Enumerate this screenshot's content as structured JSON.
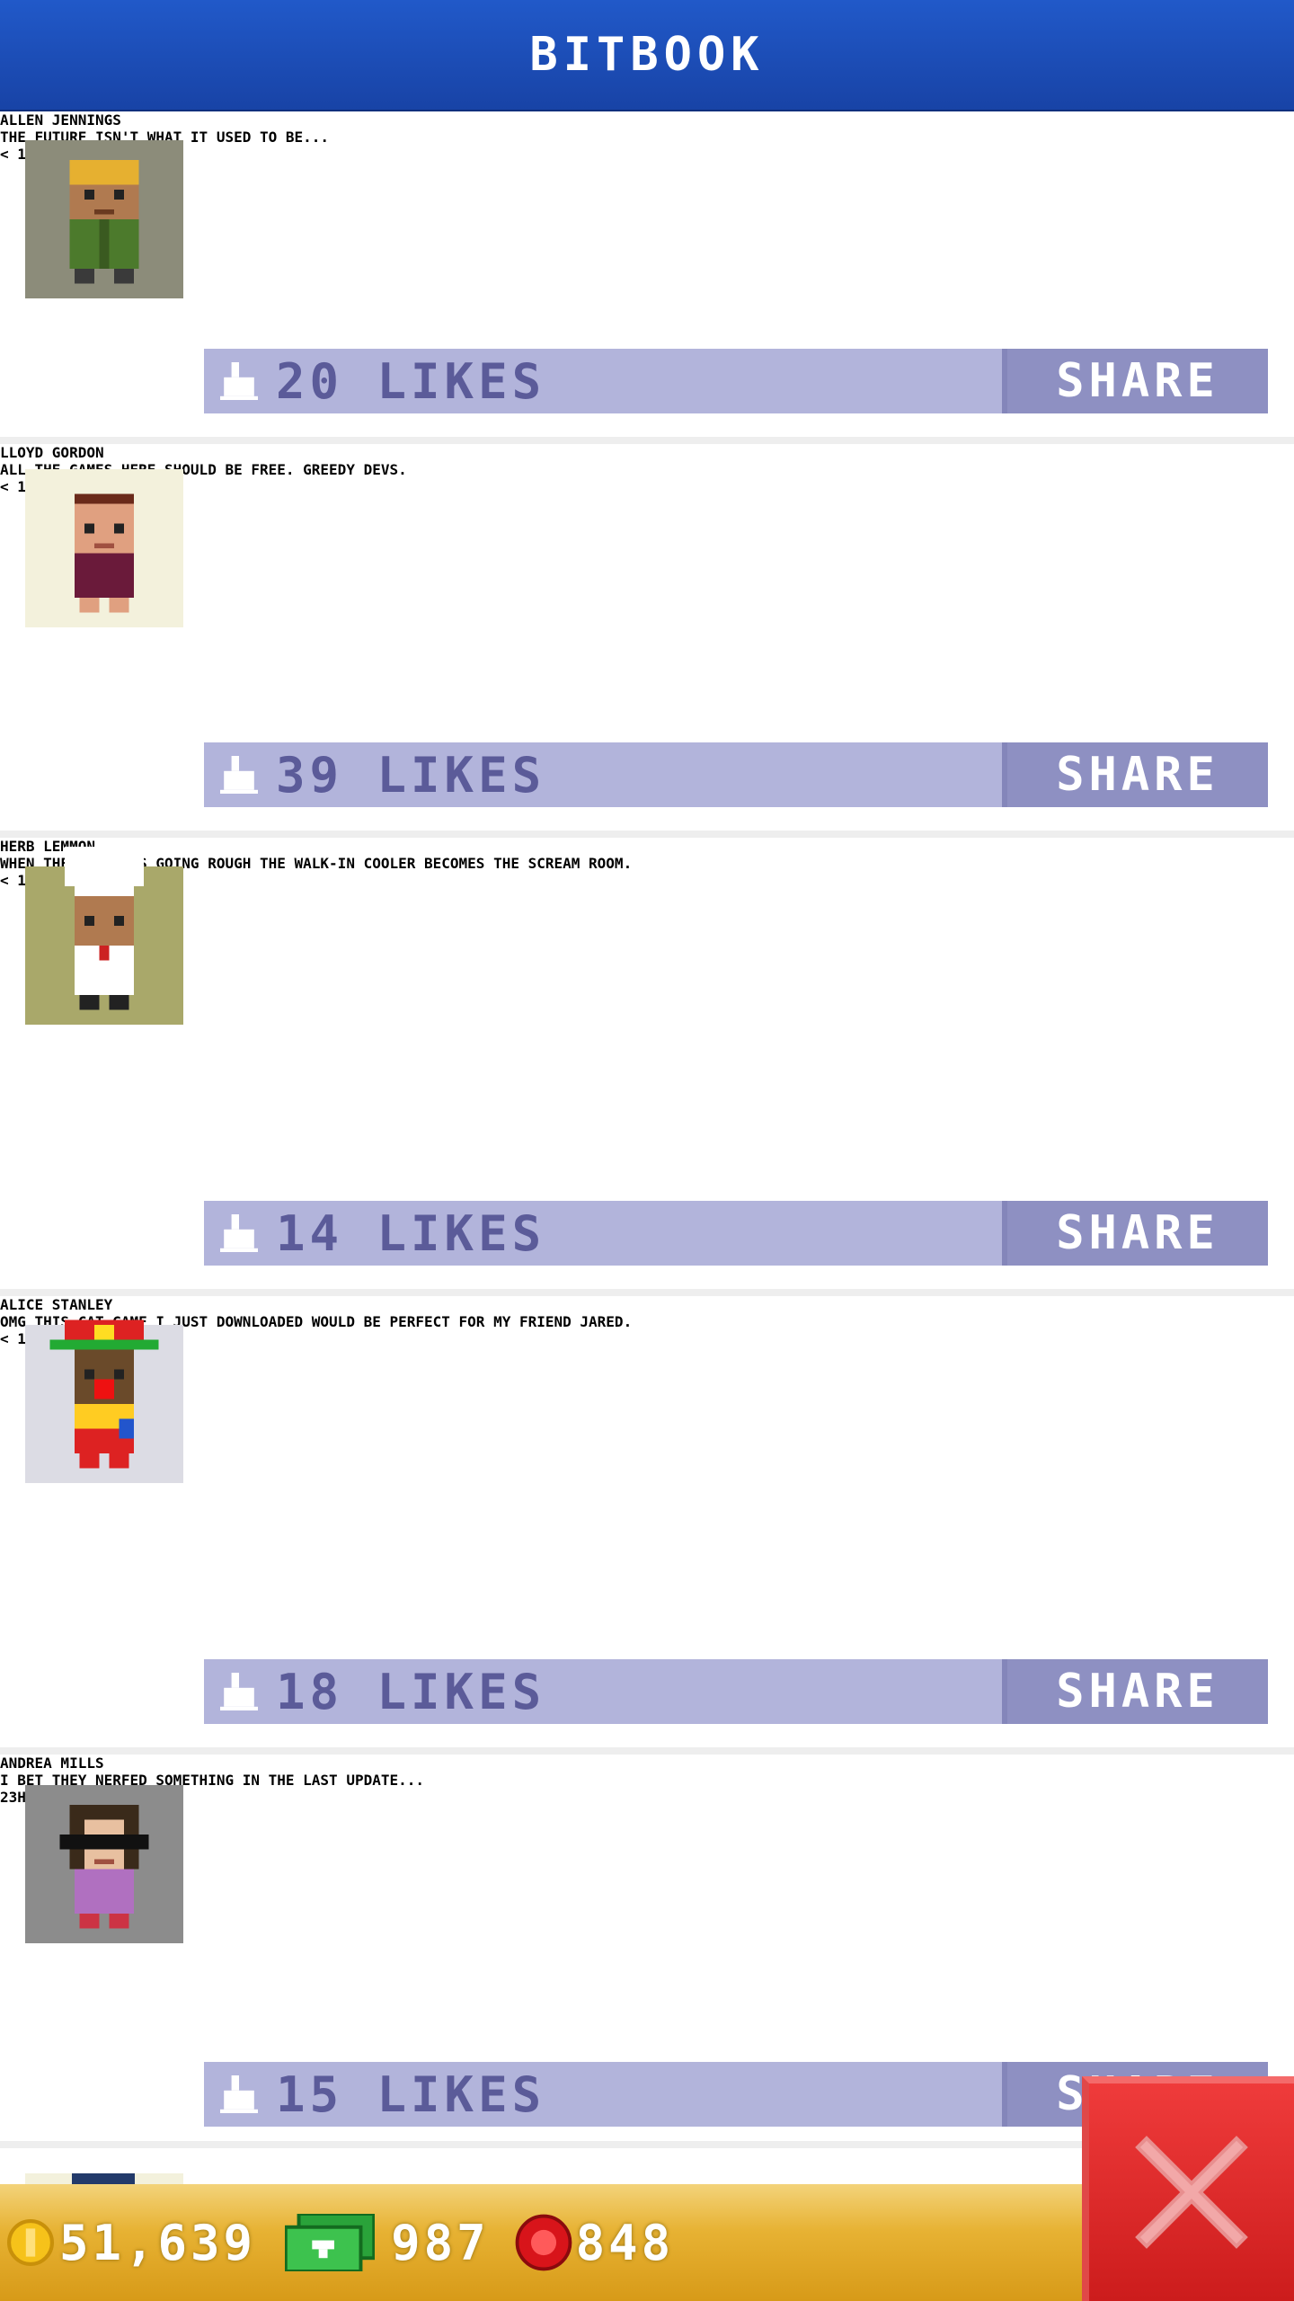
{
  "header": {
    "title": "BITBOOK"
  },
  "posts": [
    {
      "name": "ALLEN JENNINGS",
      "message": "THE FUTURE ISN'T WHAT IT USED TO BE...",
      "time": "< 1M AGO",
      "likes": "20 LIKES",
      "share": "SHARE",
      "avatar_bg": "#8c8c7a"
    },
    {
      "name": "LLOYD GORDON",
      "message": "ALL THE GAMES HERE SHOULD BE FREE.\nGREEDY DEVS.",
      "time": "< 1M AGO",
      "likes": "39 LIKES",
      "share": "SHARE",
      "avatar_bg": "#f3f1dc"
    },
    {
      "name": "HERB LEMMON",
      "message": "WHEN THE NIGHT IS GOING ROUGH THE\nWALK-IN COOLER BECOMES THE SCREAM\nROOM.",
      "time": "< 1M AGO",
      "likes": "14 LIKES",
      "share": "SHARE",
      "avatar_bg": "#a9a86a"
    },
    {
      "name": "ALICE STANLEY",
      "message": "OMG THIS CAT GAME I JUST\nDOWNLOADED WOULD BE PERFECT FOR\nMY FRIEND JARED.",
      "time": "< 1M AGO",
      "likes": "18 LIKES",
      "share": "SHARE",
      "avatar_bg": "#dcdce4"
    },
    {
      "name": "ANDREA MILLS",
      "message": "I BET THEY NERFED SOMETHING IN THE\nLAST UPDATE...",
      "time": "23H 8M AGO",
      "likes": "15 LIKES",
      "share": "SHARE",
      "avatar_bg": "#8c8c8c"
    }
  ],
  "footer": {
    "coins": "51,639",
    "bux": "987",
    "gems": "848"
  },
  "colors": {
    "header": "#1f4fbf",
    "like_bar": "#b2b4db",
    "share_bg": "#8e90c2",
    "name_text": "#5b5b99",
    "footer": "#e7b233",
    "close": "#dd2a2a"
  }
}
